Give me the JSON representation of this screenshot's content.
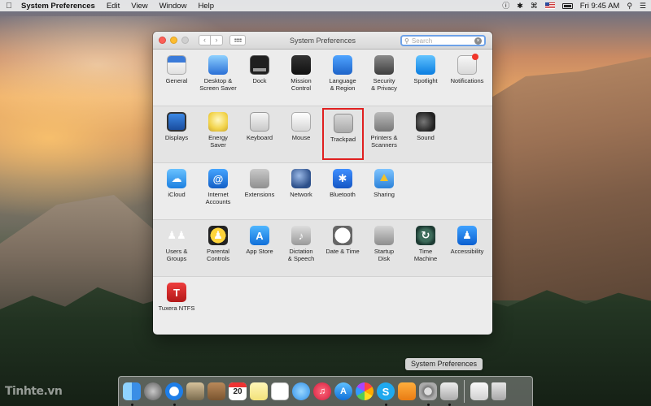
{
  "menubar": {
    "app_name": "System Preferences",
    "menus": [
      "Edit",
      "View",
      "Window",
      "Help"
    ],
    "clock": "Fri 9:45 AM"
  },
  "window": {
    "title": "System Preferences",
    "search_placeholder": "Search"
  },
  "sections": [
    {
      "panes": [
        {
          "label": "General",
          "icon": "general-icon",
          "glyph": "File New Ope"
        },
        {
          "label": "Desktop &\nScreen Saver",
          "icon": "desktop-icon"
        },
        {
          "label": "Dock",
          "icon": "dock-icon"
        },
        {
          "label": "Mission\nControl",
          "icon": "mission-control-icon"
        },
        {
          "label": "Language\n& Region",
          "icon": "language-region-icon"
        },
        {
          "label": "Security\n& Privacy",
          "icon": "security-icon"
        },
        {
          "label": "Spotlight",
          "icon": "spotlight-icon"
        },
        {
          "label": "Notifications",
          "icon": "notifications-icon"
        }
      ]
    },
    {
      "panes": [
        {
          "label": "Displays",
          "icon": "displays-icon"
        },
        {
          "label": "Energy\nSaver",
          "icon": "energy-saver-icon"
        },
        {
          "label": "Keyboard",
          "icon": "keyboard-icon"
        },
        {
          "label": "Mouse",
          "icon": "mouse-icon"
        },
        {
          "label": "Trackpad",
          "icon": "trackpad-icon",
          "selected": true
        },
        {
          "label": "Printers &\nScanners",
          "icon": "printer-icon"
        },
        {
          "label": "Sound",
          "icon": "sound-icon"
        }
      ]
    },
    {
      "panes": [
        {
          "label": "iCloud",
          "icon": "icloud-icon"
        },
        {
          "label": "Internet\nAccounts",
          "icon": "internet-accounts-icon",
          "glyph": "@"
        },
        {
          "label": "Extensions",
          "icon": "extensions-icon"
        },
        {
          "label": "Network",
          "icon": "network-icon"
        },
        {
          "label": "Bluetooth",
          "icon": "bluetooth-icon"
        },
        {
          "label": "Sharing",
          "icon": "sharing-icon"
        }
      ]
    },
    {
      "panes": [
        {
          "label": "Users &\nGroups",
          "icon": "users-groups-icon"
        },
        {
          "label": "Parental\nControls",
          "icon": "parental-controls-icon"
        },
        {
          "label": "App Store",
          "icon": "app-store-icon"
        },
        {
          "label": "Dictation\n& Speech",
          "icon": "dictation-icon"
        },
        {
          "label": "Date & Time",
          "icon": "date-time-icon",
          "glyph": "18"
        },
        {
          "label": "Startup\nDisk",
          "icon": "startup-disk-icon"
        },
        {
          "label": "Time\nMachine",
          "icon": "time-machine-icon"
        },
        {
          "label": "Accessibility",
          "icon": "accessibility-icon"
        }
      ]
    },
    {
      "panes": [
        {
          "label": "Tuxera NTFS",
          "icon": "tuxera-icon",
          "glyph": "T"
        }
      ]
    }
  ],
  "tooltip": "System Preferences",
  "dock": {
    "calendar_day": "20",
    "items": [
      "finder-icon",
      "launchpad-icon",
      "safari-icon",
      "photo-icon",
      "contacts-icon",
      "calendar-icon",
      "notes-icon",
      "reminders-icon",
      "messages-icon",
      "music-icon",
      "app-store-icon",
      "photos-icon",
      "skype-icon",
      "pages-icon",
      "system-preferences-icon",
      "preview-icon",
      "documents-icon",
      "trash-icon"
    ]
  },
  "watermark": "Tinhte.vn"
}
